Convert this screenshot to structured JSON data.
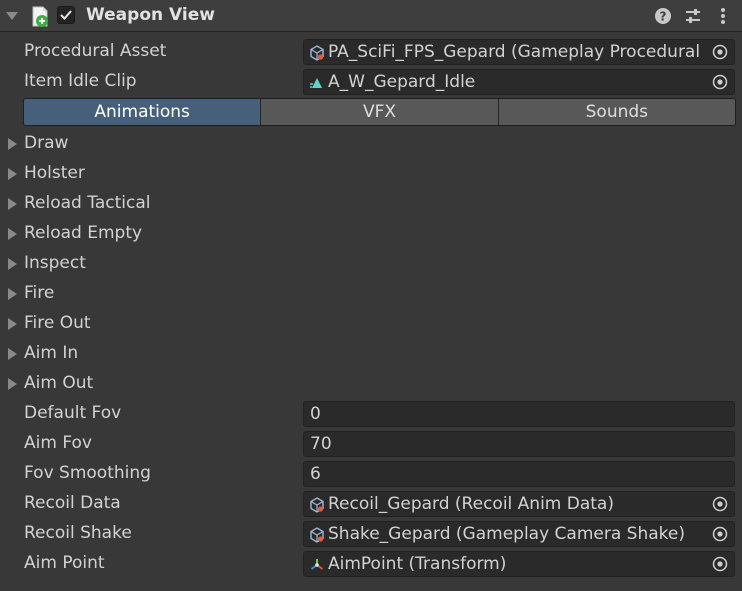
{
  "component": {
    "title": "Weapon View",
    "enabled": true,
    "icons": [
      "script-icon",
      "help-icon",
      "presets-icon",
      "more-options-icon"
    ]
  },
  "fields": {
    "procedural_asset": {
      "label": "Procedural Asset",
      "value": "PA_SciFi_FPS_Gepard (Gameplay Procedural",
      "icon": "scriptable-object-icon"
    },
    "item_idle_clip": {
      "label": "Item Idle Clip",
      "value": "A_W_Gepard_Idle",
      "icon": "animation-clip-icon"
    }
  },
  "tabs": [
    {
      "label": "Animations",
      "active": true
    },
    {
      "label": "VFX",
      "active": false
    },
    {
      "label": "Sounds",
      "active": false
    }
  ],
  "foldouts": [
    "Draw",
    "Holster",
    "Reload Tactical",
    "Reload Empty",
    "Inspect",
    "Fire",
    "Fire Out",
    "Aim In",
    "Aim Out"
  ],
  "properties": {
    "default_fov": {
      "label": "Default Fov",
      "value": "0"
    },
    "aim_fov": {
      "label": "Aim Fov",
      "value": "70"
    },
    "fov_smoothing": {
      "label": "Fov Smoothing",
      "value": "6"
    },
    "recoil_data": {
      "label": "Recoil Data",
      "value": "Recoil_Gepard (Recoil Anim Data)",
      "icon": "scriptable-object-icon"
    },
    "recoil_shake": {
      "label": "Recoil Shake",
      "value": "Shake_Gepard (Gameplay Camera Shake)",
      "icon": "scriptable-object-icon"
    },
    "aim_point": {
      "label": "Aim Point",
      "value": "AimPoint (Transform)",
      "icon": "transform-icon"
    }
  },
  "colors": {
    "background": "#383838",
    "header": "#3e3e3e",
    "field": "#2a2a2a",
    "tab": "#585858",
    "tab_active": "#46607c",
    "script_icon_accent": "#3cb043"
  }
}
